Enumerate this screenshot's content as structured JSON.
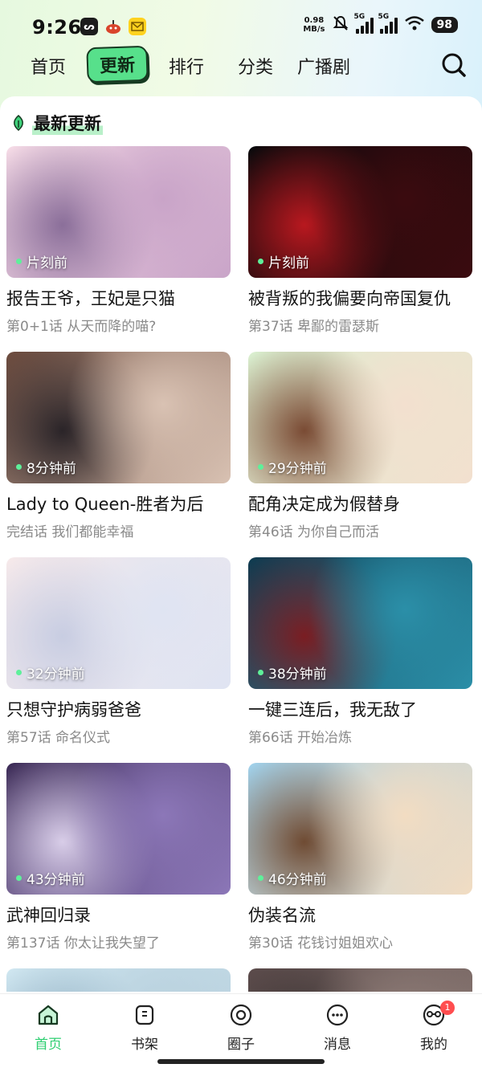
{
  "status_bar": {
    "time": "9:26",
    "net_speed_value": "0.98",
    "net_speed_unit": "MB/s",
    "sim1": "5G",
    "sim2": "5G",
    "battery": "98"
  },
  "top_nav": {
    "items": [
      "首页",
      "更新",
      "排行",
      "分类",
      "广播剧"
    ],
    "active_index": 1
  },
  "section": {
    "title": "最新更新"
  },
  "cards": [
    {
      "time": "片刻前",
      "title": "报告王爷，王妃是只猫",
      "subtitle": "第0+1话 从天而降的喵?",
      "colors": [
        "#f5dbe6",
        "#c9a4c8",
        "#8b6f9a"
      ]
    },
    {
      "time": "片刻前",
      "title": "被背叛的我偏要向帝国复仇",
      "subtitle": "第37话 卑鄙的雷瑟斯",
      "colors": [
        "#0a0a0c",
        "#3b0b0f",
        "#b8181f"
      ]
    },
    {
      "time": "8分钟前",
      "title": "Lady to Queen-胜者为后",
      "subtitle": "完结话 我们都能幸福",
      "colors": [
        "#6b4a3d",
        "#d9c2b3",
        "#2a2428"
      ]
    },
    {
      "time": "29分钟前",
      "title": "配角决定成为假替身",
      "subtitle": "第46话 为你自己而活",
      "colors": [
        "#d9efcf",
        "#f3e0cf",
        "#7a4b34"
      ]
    },
    {
      "time": "32分钟前",
      "title": "只想守护病弱爸爸",
      "subtitle": "第57话 命名仪式",
      "colors": [
        "#f6e9ea",
        "#dfe4f2",
        "#c8cde2"
      ]
    },
    {
      "time": "38分钟前",
      "title": "一键三连后，我无敌了",
      "subtitle": "第66话 开始冶炼",
      "colors": [
        "#0f3a4f",
        "#2b8fa8",
        "#7a1d22"
      ]
    },
    {
      "time": "43分钟前",
      "title": "武神回归录",
      "subtitle": "第137话 你太让我失望了",
      "colors": [
        "#3b2a55",
        "#8c77b8",
        "#d8cde8"
      ]
    },
    {
      "time": "46分钟前",
      "title": "伪装名流",
      "subtitle": "第30话 花钱讨姐姐欢心",
      "colors": [
        "#9fd0ea",
        "#f2dcc2",
        "#6f4b33"
      ]
    },
    {
      "time": "",
      "title": "",
      "subtitle": "",
      "colors": [
        "#cfe6f0",
        "#b8d0dd",
        "#8aa9bd"
      ]
    },
    {
      "time": "",
      "title": "",
      "subtitle": "",
      "colors": [
        "#5a4a4a",
        "#8d7b76",
        "#2e2828"
      ]
    }
  ],
  "bottom_nav": {
    "tabs": [
      "首页",
      "书架",
      "圈子",
      "消息",
      "我的"
    ],
    "active_index": 0,
    "badge_count": "1"
  }
}
